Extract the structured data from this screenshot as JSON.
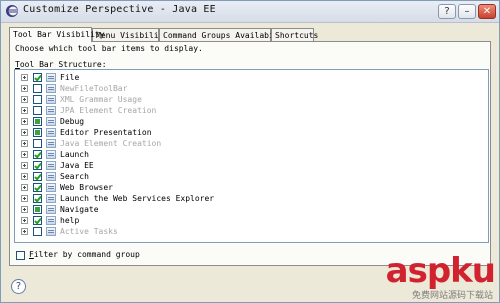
{
  "window": {
    "title": "Customize Perspective - Java EE",
    "buttons": {
      "help_glyph": "?",
      "minimize_glyph": "–",
      "close_glyph": "✕"
    }
  },
  "tabs": [
    {
      "label": "Tool Bar Visibility",
      "active": true
    },
    {
      "label": "Menu Visibility",
      "active": false
    },
    {
      "label": "Command Groups Availability",
      "active": false
    },
    {
      "label": "Shortcuts",
      "active": false
    }
  ],
  "content": {
    "description": "Choose which tool bar items to display.",
    "structure_label_first": "T",
    "structure_label_rest": "ool Bar Structure:"
  },
  "tree_items": [
    {
      "label": "File",
      "state": "checked",
      "enabled": true
    },
    {
      "label": "NewFileToolBar",
      "state": "unchecked",
      "enabled": false
    },
    {
      "label": "XML Grammar Usage",
      "state": "unchecked",
      "enabled": false
    },
    {
      "label": "JPA Element Creation",
      "state": "unchecked",
      "enabled": false
    },
    {
      "label": "Debug",
      "state": "partial",
      "enabled": true
    },
    {
      "label": "Editor Presentation",
      "state": "partial",
      "enabled": true
    },
    {
      "label": "Java Element Creation",
      "state": "unchecked",
      "enabled": false
    },
    {
      "label": "Launch",
      "state": "checked",
      "enabled": true
    },
    {
      "label": "Java EE",
      "state": "checked",
      "enabled": true
    },
    {
      "label": "Search",
      "state": "checked",
      "enabled": true
    },
    {
      "label": "Web Browser",
      "state": "checked",
      "enabled": true
    },
    {
      "label": "Launch the Web Services Explorer",
      "state": "checked",
      "enabled": true
    },
    {
      "label": "Navigate",
      "state": "partial",
      "enabled": true
    },
    {
      "label": "help",
      "state": "checked",
      "enabled": true
    },
    {
      "label": "Active Tasks",
      "state": "unchecked",
      "enabled": false
    }
  ],
  "filter": {
    "label_first": "F",
    "label_rest": "ilter by command group",
    "checked": false
  },
  "footer": {
    "help_glyph": "?"
  },
  "watermark": {
    "brand": "aspku",
    "subtext": "免费网站源码下载站"
  }
}
